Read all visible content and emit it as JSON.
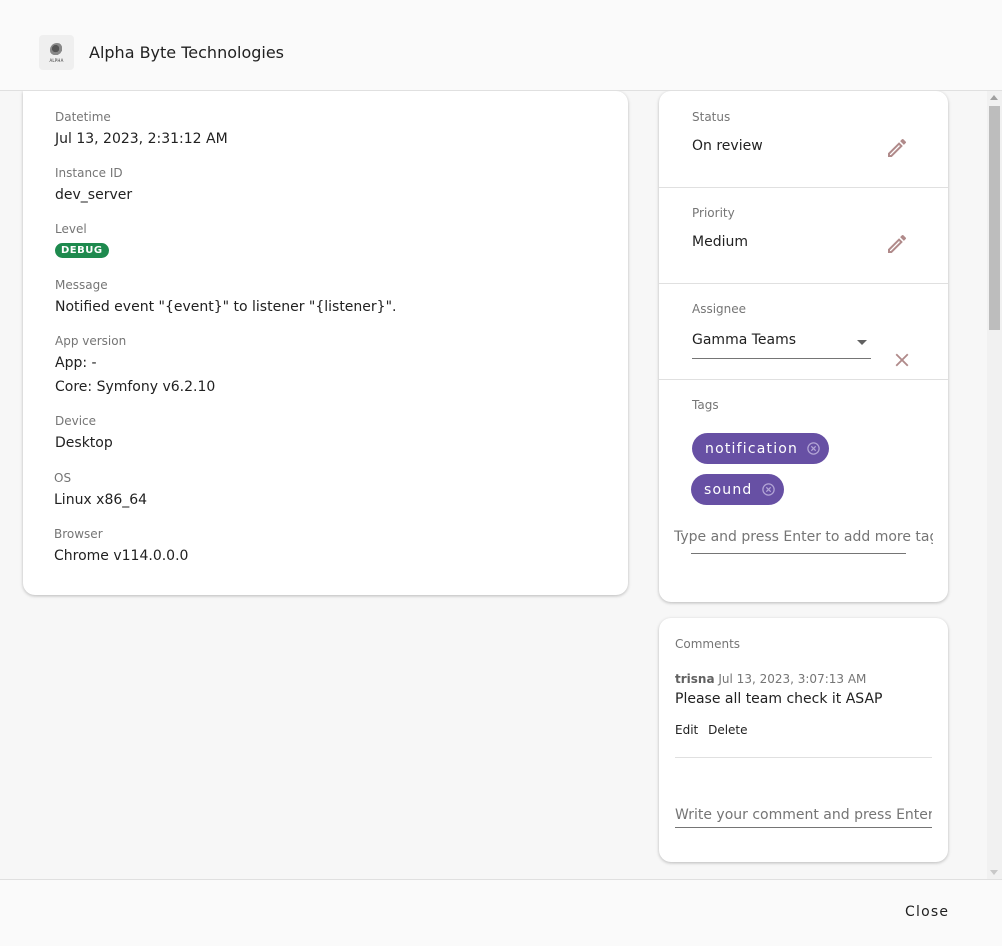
{
  "header": {
    "logo_icon": "alpha-logo-icon",
    "logo_wordmark": "ALPHA",
    "title": "Alpha Byte Technologies"
  },
  "details": {
    "datetime": {
      "label": "Datetime",
      "value": "Jul 13, 2023, 2:31:12 AM"
    },
    "instance_id": {
      "label": "Instance ID",
      "value": "dev_server"
    },
    "level": {
      "label": "Level",
      "value": "DEBUG",
      "color": "#1e8a4e"
    },
    "message": {
      "label": "Message",
      "value": "Notified event \"{event}\" to listener \"{listener}\"."
    },
    "app_version": {
      "label": "App version",
      "app": "App: -",
      "core": "Core: Symfony v6.2.10"
    },
    "device": {
      "label": "Device",
      "value": "Desktop"
    },
    "os": {
      "label": "OS",
      "value": "Linux x86_64"
    },
    "browser": {
      "label": "Browser",
      "value": "Chrome v114.0.0.0"
    }
  },
  "sidebar": {
    "status": {
      "label": "Status",
      "value": "On review",
      "edit_icon": "pencil-icon"
    },
    "priority": {
      "label": "Priority",
      "value": "Medium",
      "edit_icon": "pencil-icon"
    },
    "assignee": {
      "label": "Assignee",
      "value": "Gamma Teams",
      "clear_icon": "close-icon"
    },
    "tags": {
      "label": "Tags",
      "items": [
        "notification",
        "sound"
      ],
      "chip_color": "#6750a4",
      "input_placeholder": "Type and press Enter to add more tags"
    }
  },
  "comments": {
    "label": "Comments",
    "items": [
      {
        "author": "trisna",
        "timestamp": "Jul 13, 2023, 3:07:13 AM",
        "text": "Please all team check it ASAP",
        "edit_label": "Edit",
        "delete_label": "Delete"
      }
    ],
    "input_placeholder": "Write your comment and press Enter"
  },
  "footer": {
    "close_label": "Close"
  },
  "colors": {
    "accent_icon": "#b08a8a",
    "chip": "#6750a4",
    "badge_debug": "#1e8a4e"
  }
}
